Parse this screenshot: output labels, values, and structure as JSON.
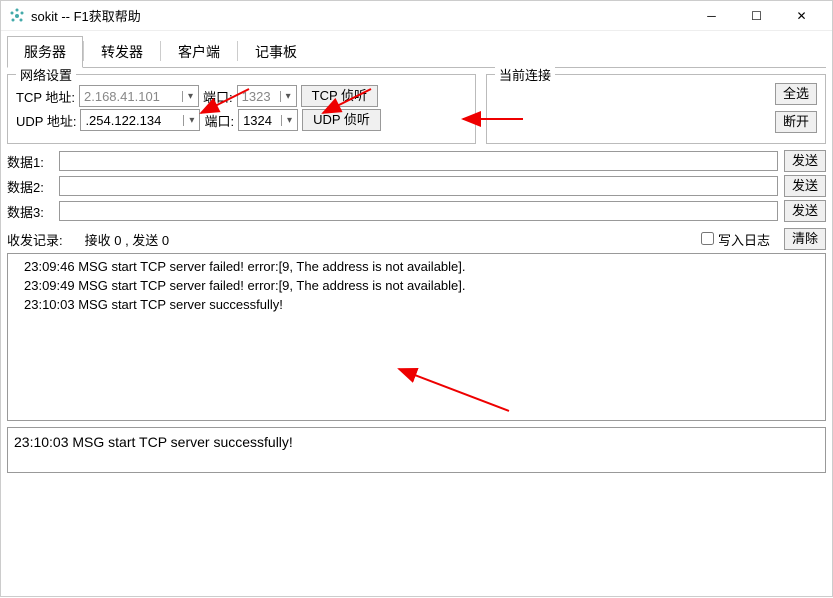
{
  "title": "sokit -- F1获取帮助",
  "tabs": [
    "服务器",
    "转发器",
    "客户端",
    "记事板"
  ],
  "activeTab": 0,
  "network": {
    "legend": "网络设置",
    "tcp_label": "TCP 地址:",
    "tcp_addr": "2.168.41.101",
    "tcp_port_label": "端口:",
    "tcp_port": "1323",
    "tcp_btn": "TCP 侦听",
    "udp_label": "UDP 地址:",
    "udp_addr": ".254.122.134",
    "udp_port_label": "端口:",
    "udp_port": "1324",
    "udp_btn": "UDP 侦听"
  },
  "connections": {
    "legend": "当前连接",
    "select_all": "全选",
    "disconnect": "断开"
  },
  "data_rows": {
    "d1": "数据1:",
    "d2": "数据2:",
    "d3": "数据3:",
    "send": "发送"
  },
  "record": {
    "label": "收发记录:",
    "stats": "接收 0 , 发送 0",
    "write_log": "写入日志",
    "clear": "清除"
  },
  "log_lines": [
    "23:09:46 MSG start TCP server failed! error:[9, The address is not available].",
    "23:09:49 MSG start TCP server failed! error:[9, The address is not available].",
    "23:10:03 MSG start TCP server successfully!"
  ],
  "status_line": "23:10:03 MSG start TCP server successfully!"
}
